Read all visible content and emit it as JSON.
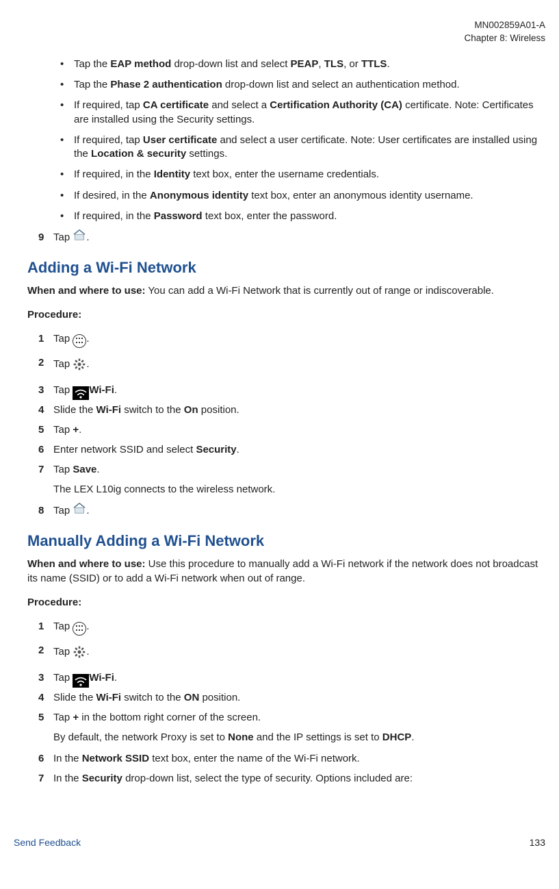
{
  "header": {
    "doc_id": "MN002859A01-A",
    "chapter": "Chapter 8:  Wireless"
  },
  "intro_bullets": [
    {
      "parts": [
        {
          "t": "Tap the "
        },
        {
          "t": "EAP method",
          "b": 1
        },
        {
          "t": " drop-down list and select "
        },
        {
          "t": "PEAP",
          "b": 1
        },
        {
          "t": ", "
        },
        {
          "t": "TLS",
          "b": 1
        },
        {
          "t": ", or "
        },
        {
          "t": "TTLS",
          "b": 1
        },
        {
          "t": "."
        }
      ]
    },
    {
      "parts": [
        {
          "t": "Tap the "
        },
        {
          "t": "Phase 2 authentication",
          "b": 1
        },
        {
          "t": " drop-down list and select an authentication method."
        }
      ]
    },
    {
      "parts": [
        {
          "t": "If required, tap "
        },
        {
          "t": "CA certificate",
          "b": 1
        },
        {
          "t": " and select a "
        },
        {
          "t": "Certification Authority (CA)",
          "b": 1
        },
        {
          "t": " certificate. Note: Certificates are installed using the Security settings."
        }
      ]
    },
    {
      "parts": [
        {
          "t": "If required, tap "
        },
        {
          "t": "User certificate",
          "b": 1
        },
        {
          "t": " and select a user certificate. Note: User certificates are installed using the "
        },
        {
          "t": "Location & security",
          "b": 1
        },
        {
          "t": " settings."
        }
      ]
    },
    {
      "parts": [
        {
          "t": "If required, in the "
        },
        {
          "t": "Identity",
          "b": 1
        },
        {
          "t": " text box, enter the username credentials."
        }
      ]
    },
    {
      "parts": [
        {
          "t": "If desired, in the "
        },
        {
          "t": "Anonymous identity",
          "b": 1
        },
        {
          "t": " text box, enter an anonymous identity username."
        }
      ]
    },
    {
      "parts": [
        {
          "t": "If required, in the "
        },
        {
          "t": "Password",
          "b": 1
        },
        {
          "t": " text box, enter the password."
        }
      ]
    }
  ],
  "step_intro_9": {
    "num": "9",
    "pre": "Tap ",
    "post": "."
  },
  "section1": {
    "title": "Adding a Wi-Fi Network",
    "when_label": "When and where to use:",
    "when_text": " You can add a Wi-Fi Network that is currently out of range or indiscoverable.",
    "proc_label": "Procedure:",
    "steps": [
      {
        "num": "1",
        "type": "icon",
        "icon": "apps",
        "pre": "Tap ",
        "post": "."
      },
      {
        "num": "2",
        "type": "icon",
        "icon": "settings",
        "pre": "Tap ",
        "post": "."
      },
      {
        "num": "3",
        "type": "wifi",
        "pre": "Tap ",
        "label": "Wi-Fi",
        "post": "."
      },
      {
        "num": "4",
        "type": "rich",
        "parts": [
          {
            "t": "Slide the "
          },
          {
            "t": "Wi-Fi",
            "b": 1
          },
          {
            "t": " switch to the "
          },
          {
            "t": "On",
            "b": 1
          },
          {
            "t": " position."
          }
        ]
      },
      {
        "num": "5",
        "type": "rich",
        "parts": [
          {
            "t": "Tap "
          },
          {
            "t": "+",
            "b": 1
          },
          {
            "t": "."
          }
        ]
      },
      {
        "num": "6",
        "type": "rich",
        "parts": [
          {
            "t": "Enter network SSID and select "
          },
          {
            "t": "Security",
            "b": 1
          },
          {
            "t": "."
          }
        ]
      },
      {
        "num": "7",
        "type": "rich",
        "parts": [
          {
            "t": "Tap "
          },
          {
            "t": "Save",
            "b": 1
          },
          {
            "t": "."
          }
        ],
        "sub": "The LEX L10ig connects to the wireless network."
      },
      {
        "num": "8",
        "type": "icon",
        "icon": "home",
        "pre": "Tap ",
        "post": "."
      }
    ]
  },
  "section2": {
    "title": "Manually Adding a Wi-Fi Network",
    "when_label": "When and where to use:",
    "when_text": " Use this procedure to manually add a Wi-Fi network if the network does not broadcast its name (SSID) or to add a Wi-Fi network when out of range.",
    "proc_label": "Procedure:",
    "steps": [
      {
        "num": "1",
        "type": "icon",
        "icon": "apps",
        "pre": "Tap ",
        "post": "."
      },
      {
        "num": "2",
        "type": "icon",
        "icon": "settings",
        "pre": "Tap ",
        "post": "."
      },
      {
        "num": "3",
        "type": "wifi",
        "pre": "Tap ",
        "label": "Wi-Fi",
        "post": "."
      },
      {
        "num": "4",
        "type": "rich",
        "parts": [
          {
            "t": "Slide the "
          },
          {
            "t": "Wi-Fi",
            "b": 1
          },
          {
            "t": " switch to the "
          },
          {
            "t": "ON",
            "b": 1
          },
          {
            "t": " position."
          }
        ]
      },
      {
        "num": "5",
        "type": "rich",
        "parts": [
          {
            "t": "Tap "
          },
          {
            "t": "+",
            "b": 1
          },
          {
            "t": " in the bottom right corner of the screen."
          }
        ],
        "sub_parts": [
          {
            "t": "By default, the network Proxy is set to "
          },
          {
            "t": "None",
            "b": 1
          },
          {
            "t": " and the IP settings is set to "
          },
          {
            "t": "DHCP",
            "b": 1
          },
          {
            "t": "."
          }
        ]
      },
      {
        "num": "6",
        "type": "rich",
        "parts": [
          {
            "t": "In the "
          },
          {
            "t": "Network SSID",
            "b": 1
          },
          {
            "t": " text box, enter the name of the Wi-Fi network."
          }
        ]
      },
      {
        "num": "7",
        "type": "rich",
        "parts": [
          {
            "t": "In the "
          },
          {
            "t": "Security",
            "b": 1
          },
          {
            "t": " drop-down list, select the type of security. Options included are:"
          }
        ]
      }
    ]
  },
  "footer": {
    "link": "Send Feedback",
    "page": "133"
  }
}
